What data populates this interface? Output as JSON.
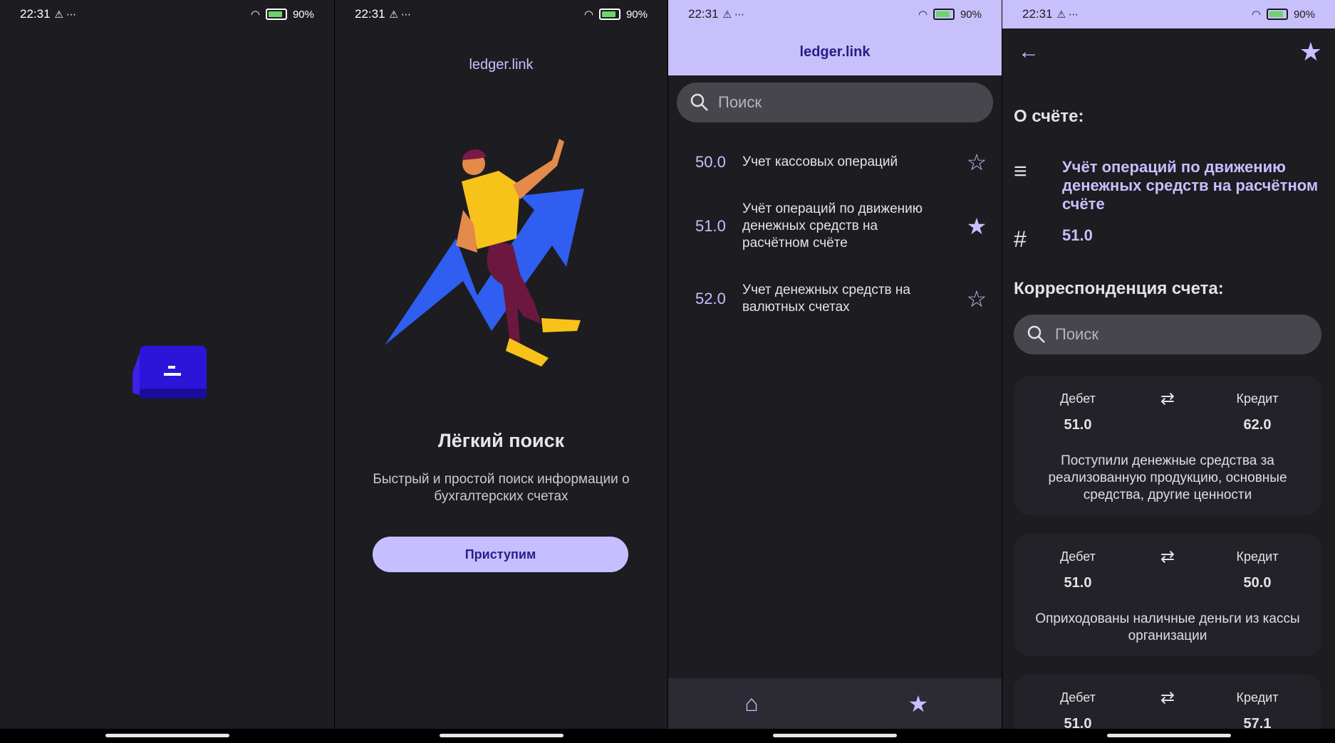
{
  "status": {
    "time": "22:31",
    "battery": "90%"
  },
  "app": {
    "site": "ledger.link"
  },
  "onboarding": {
    "title": "Лёгкий поиск",
    "description": "Быстрый и простой поиск информации о бухгалтерских счетах",
    "button": "Приступим"
  },
  "list": {
    "search_placeholder": "Поиск",
    "accounts": [
      {
        "code": "50.0",
        "name": "Учет кассовых операций",
        "starred": false
      },
      {
        "code": "51.0",
        "name": "Учёт операций по движению денежных средств на расчётном счёте",
        "starred": true
      },
      {
        "code": "52.0",
        "name": "Учет денежных средств на валютных счетах",
        "starred": false
      }
    ]
  },
  "detail": {
    "about_title": "О счёте:",
    "account_name": "Учёт операций по движению денежных средств на расчётном счёте",
    "account_code": "51.0",
    "corr_title": "Корреспонденция счета:",
    "search_placeholder": "Поиск",
    "debit_label": "Дебет",
    "credit_label": "Кредит",
    "entries": [
      {
        "debit": "51.0",
        "credit": "62.0",
        "text": "Поступили денежные средства за реализованную продукцию, основные средства, другие ценности"
      },
      {
        "debit": "51.0",
        "credit": "50.0",
        "text": "Оприходованы наличные деньги из кассы организации"
      },
      {
        "debit": "51.0",
        "credit": "57.1",
        "text": ""
      }
    ]
  },
  "colors": {
    "accent": "#c5c0ff",
    "background": "#1d1c21",
    "appbar": "#c8c0fb",
    "logo": "#2c14d9"
  }
}
